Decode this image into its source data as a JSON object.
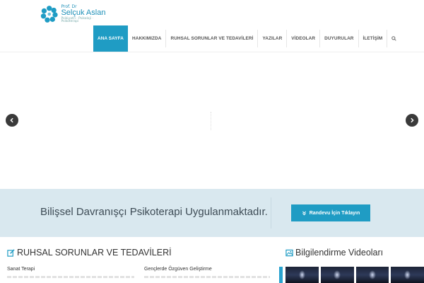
{
  "logo": {
    "prefix": "Prof. Dr",
    "name": "Selçuk Aslan",
    "subtitle": "Psikiyatri · Psikoloji · Psikoterapi"
  },
  "nav": {
    "items": [
      {
        "label": "ANA SAYFA",
        "active": true
      },
      {
        "label": "HAKKIMIZDA",
        "active": false
      },
      {
        "label": "RUHSAL SORUNLAR VE TEDAVİLERİ",
        "active": false
      },
      {
        "label": "YAZILAR",
        "active": false
      },
      {
        "label": "VİDEOLAR",
        "active": false
      },
      {
        "label": "DUYURULAR",
        "active": false
      },
      {
        "label": "İLETİŞİM",
        "active": false
      }
    ],
    "search_icon": "search-icon"
  },
  "slider": {
    "prev_icon": "chevron-left-icon",
    "next_icon": "chevron-right-icon"
  },
  "band": {
    "text": "Bilişsel Davranışçı Psikoterapi Uygulanmaktadır.",
    "button_label": "Randevu İçin Tıklayın",
    "button_icon": "chevron-double-down-icon"
  },
  "sections": {
    "left": {
      "title": "RUHSAL SORUNLAR VE TEDAVİLERİ",
      "icon": "edit-icon",
      "links": [
        "Sanat Terapi",
        "Gençlerde Özgüven Geliştirme"
      ]
    },
    "right": {
      "title": "Bilgilendirme Videoları",
      "icon": "image-icon"
    }
  },
  "colors": {
    "accent": "#1f9cc4",
    "band_bg": "#d9e8ef",
    "band_text": "#3d4b55",
    "arrow_bg": "#3a3a3a"
  }
}
